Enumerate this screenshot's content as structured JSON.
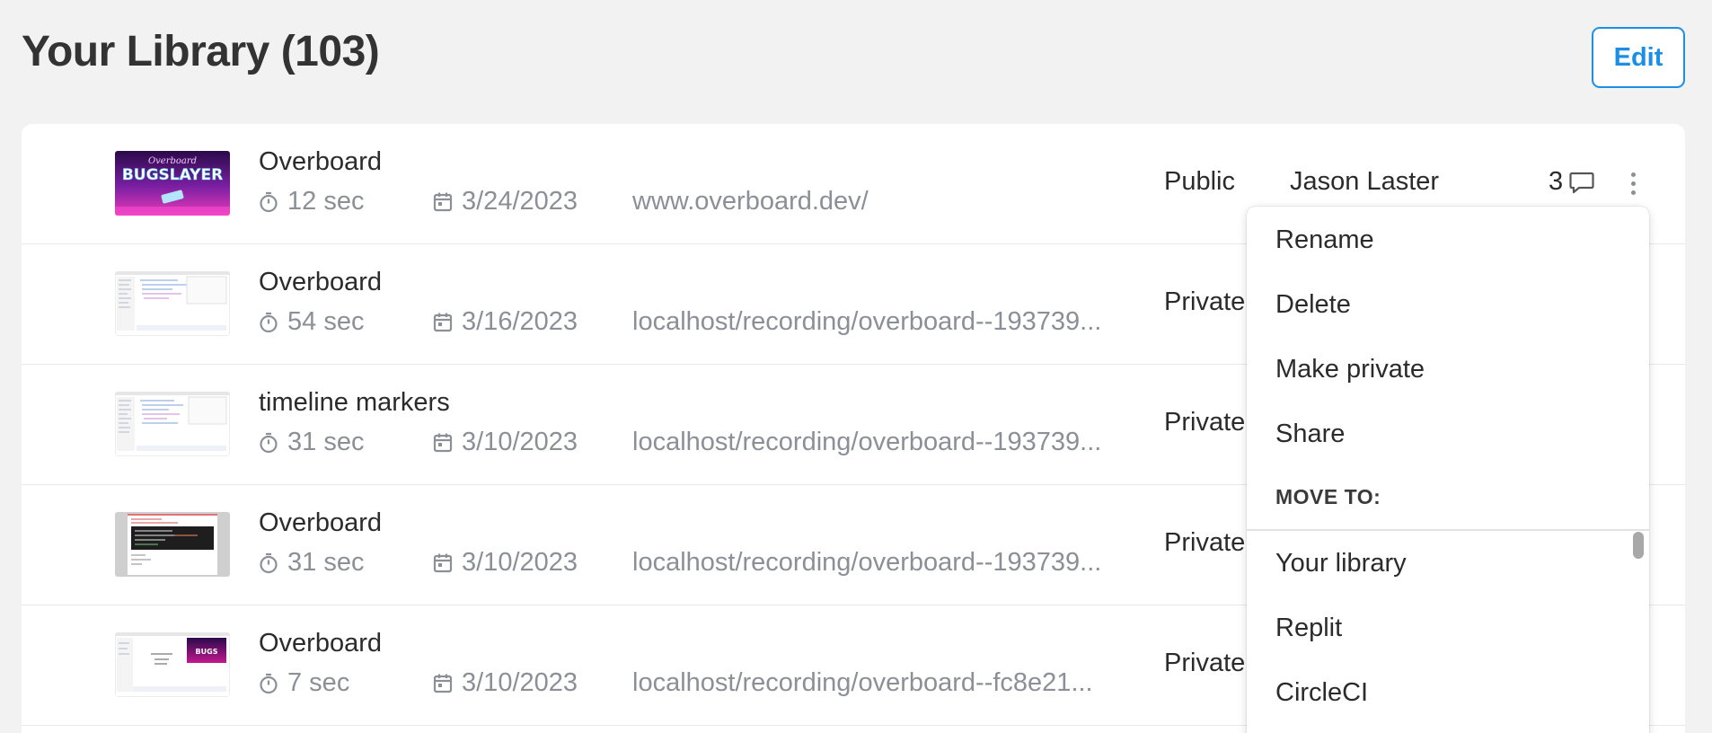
{
  "header": {
    "title": "Your Library",
    "count": "(103)",
    "edit_label": "Edit"
  },
  "recordings": [
    {
      "title": "Overboard",
      "duration": "12 sec",
      "date": "3/24/2023",
      "url": "www.overboard.dev/",
      "privacy": "Public",
      "owner": "Jason Laster",
      "comments": "3",
      "thumbnail": "bugslayer-game-thumbnail"
    },
    {
      "title": "Overboard",
      "duration": "54 sec",
      "date": "3/16/2023",
      "url": "localhost/recording/overboard--193739...",
      "privacy": "Private",
      "thumbnail": "devtools-screenshot-thumbnail"
    },
    {
      "title": "timeline markers",
      "duration": "31 sec",
      "date": "3/10/2023",
      "url": "localhost/recording/overboard--193739...",
      "privacy": "Private",
      "thumbnail": "devtools-screenshot-thumbnail"
    },
    {
      "title": "Overboard",
      "duration": "31 sec",
      "date": "3/10/2023",
      "url": "localhost/recording/overboard--193739...",
      "privacy": "Private",
      "thumbnail": "terminal-error-thumbnail"
    },
    {
      "title": "Overboard",
      "duration": "7 sec",
      "date": "3/10/2023",
      "url": "localhost/recording/overboard--fc8e21...",
      "privacy": "Private",
      "thumbnail": "devtools-game-thumbnail"
    }
  ],
  "context_menu": {
    "items": [
      "Rename",
      "Delete",
      "Make private",
      "Share"
    ],
    "move_heading": "MOVE TO:",
    "move_targets": [
      "Your library",
      "Replit",
      "CircleCI"
    ]
  },
  "thumbnail_text": {
    "logo_script": "Overboard",
    "logo_main": "BUGSLAYER"
  },
  "colors": {
    "accent": "#1a8fe3",
    "background": "#f2f2f2",
    "muted_text": "#8b8f96"
  }
}
